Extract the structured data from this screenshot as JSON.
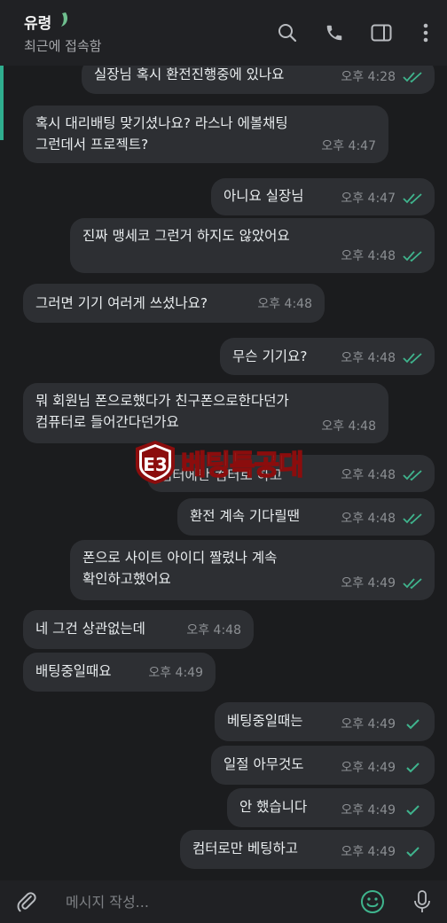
{
  "header": {
    "name": "유령",
    "status": "최근에 접속함",
    "emoji_icon": "moon-leaf-icon"
  },
  "messages": [
    {
      "dir": "out",
      "text": "실장님 혹시 환전진행중에 있나요",
      "time": "오후 4:28",
      "status": "read"
    },
    {
      "dir": "in",
      "text": "혹시 대리배팅 맞기셨나요? 라스나 에볼채팅\n그런데서 프로젝트?",
      "time": "오후 4:47"
    },
    {
      "dir": "out",
      "text": "아니요 실장님",
      "time": "오후 4:47",
      "status": "read"
    },
    {
      "dir": "out",
      "text": "진짜 맹세코 그런거 하지도 않았어요",
      "time": "오후 4:48",
      "status": "read"
    },
    {
      "dir": "in",
      "text": "그러면 기기 여러게 쓰셨나요?",
      "time": "오후 4:48"
    },
    {
      "dir": "out",
      "text": "무슨 기기요?",
      "time": "오후 4:48",
      "status": "read"
    },
    {
      "dir": "in",
      "text": "뭐 회원님 폰으로했다가 친구폰으로한다던가\n컴퓨터로 들어간다던가요",
      "time": "오후 4:48"
    },
    {
      "dir": "out",
      "text": "컴터에만 컴터로 하고",
      "time": "오후 4:48",
      "status": "read"
    },
    {
      "dir": "out",
      "text": "환전 계속 기다릴땐",
      "time": "오후 4:48",
      "status": "read"
    },
    {
      "dir": "out",
      "text": "폰으로 사이트 아이디 짤렸나 계속\n확인하고했어요",
      "time": "오후 4:49",
      "status": "read"
    },
    {
      "dir": "in",
      "text": "네 그건 상관없는데",
      "time": "오후 4:48"
    },
    {
      "dir": "in",
      "text": "배팅중일때요",
      "time": "오후 4:49"
    },
    {
      "dir": "out",
      "text": "베팅중일때는",
      "time": "오후 4:49",
      "status": "sent"
    },
    {
      "dir": "out",
      "text": "일절 아무것도",
      "time": "오후 4:49",
      "status": "sent"
    },
    {
      "dir": "out",
      "text": "안 했습니다",
      "time": "오후 4:49",
      "status": "sent"
    },
    {
      "dir": "out",
      "text": "컴터로만 베팅하고",
      "time": "오후 4:49",
      "status": "sent"
    }
  ],
  "composer": {
    "placeholder": "메시지 작성..."
  },
  "watermark": {
    "text": "베팅특공대",
    "logo_icon": "shield-logo-icon"
  },
  "colors": {
    "background": "#1b1c1e",
    "bubble": "#2d2f33",
    "header": "#202124",
    "accent": "#2fae8f",
    "tick": "#3fb48d"
  }
}
